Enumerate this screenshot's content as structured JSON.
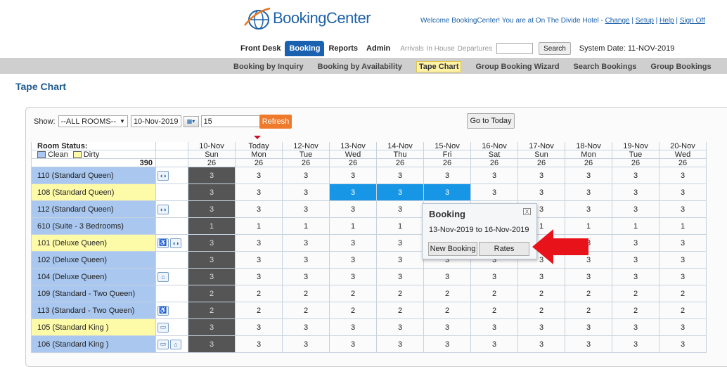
{
  "header": {
    "logo_text": "BookingCenter",
    "welcome_text": "Welcome BookingCenter! You are at On The Divide Hotel - ",
    "links": [
      "Change",
      "Setup",
      "Help",
      "Sign Off"
    ]
  },
  "nav": {
    "tabs": [
      "Front Desk",
      "Booking",
      "Reports",
      "Admin"
    ],
    "active_tab": "Booking",
    "quick_links": [
      "Arrivals",
      "In House",
      "Departures"
    ],
    "search_value": "",
    "search_button": "Search",
    "system_date": "System Date: 11-NOV-2019"
  },
  "subnav": {
    "items": [
      "Booking by Inquiry",
      "Booking by Availability",
      "Tape Chart",
      "Group Booking Wizard",
      "Search Bookings",
      "Group Bookings"
    ],
    "active": "Tape Chart"
  },
  "page_title": "Tape Chart",
  "toolbar": {
    "show_label": "Show:",
    "rooms_select": "--ALL ROOMS--",
    "date_value": "10-Nov-2019",
    "days_value": "15",
    "refresh_label": "Refresh",
    "goto_today_label": "Go to Today"
  },
  "grid": {
    "status_label": "Room Status:",
    "legend_clean": "Clean",
    "legend_dirty": "Dirty",
    "total": "390",
    "dates": [
      "10-Nov",
      "Today",
      "12-Nov",
      "13-Nov",
      "14-Nov",
      "15-Nov",
      "16-Nov",
      "17-Nov",
      "18-Nov",
      "19-Nov",
      "20-Nov"
    ],
    "days": [
      "Sun",
      "Mon",
      "Tue",
      "Wed",
      "Thu",
      "Fri",
      "Sat",
      "Sun",
      "Mon",
      "Tue",
      "Wed"
    ],
    "totals": [
      "26",
      "26",
      "26",
      "26",
      "26",
      "26",
      "26",
      "26",
      "26",
      "26",
      "26"
    ],
    "rooms": [
      {
        "name": "110 (Standard Queen)",
        "status": "clean",
        "icons": [
          "hearing-icon"
        ],
        "values": [
          "3",
          "3",
          "3",
          "3",
          "3",
          "3",
          "3",
          "3",
          "3",
          "3",
          "3"
        ]
      },
      {
        "name": "108 (Standard Queen)",
        "status": "dirty",
        "icons": [],
        "values": [
          "3",
          "3",
          "3",
          "3",
          "3",
          "3",
          "3",
          "3",
          "3",
          "3",
          "3"
        ]
      },
      {
        "name": "112 (Standard Queen)",
        "status": "clean",
        "icons": [
          "hearing-icon"
        ],
        "values": [
          "3",
          "3",
          "3",
          "3",
          "3",
          "3",
          "3",
          "3",
          "3",
          "3",
          "3"
        ]
      },
      {
        "name": "610 (Suite - 3 Bedrooms)",
        "status": "clean",
        "icons": [],
        "values": [
          "1",
          "1",
          "1",
          "1",
          "1",
          "1",
          "1",
          "1",
          "1",
          "1",
          "1"
        ]
      },
      {
        "name": "101 (Deluxe Queen)",
        "status": "dirty",
        "icons": [
          "wheelchair-icon",
          "hearing-icon"
        ],
        "values": [
          "3",
          "3",
          "3",
          "3",
          "3",
          "3",
          "3",
          "3",
          "3",
          "3",
          "3"
        ]
      },
      {
        "name": "102 (Deluxe Queen)",
        "status": "clean",
        "icons": [],
        "values": [
          "3",
          "3",
          "3",
          "3",
          "3",
          "3",
          "3",
          "3",
          "3",
          "3",
          "3"
        ]
      },
      {
        "name": "104 (Deluxe Queen)",
        "status": "clean",
        "icons": [
          "pet-icon"
        ],
        "values": [
          "3",
          "3",
          "3",
          "3",
          "3",
          "3",
          "3",
          "3",
          "3",
          "3",
          "3"
        ]
      },
      {
        "name": "109 (Standard - Two Queen)",
        "status": "clean",
        "icons": [],
        "values": [
          "2",
          "2",
          "2",
          "2",
          "2",
          "2",
          "2",
          "2",
          "2",
          "2",
          "2"
        ]
      },
      {
        "name": "113 (Standard - Two Queen)",
        "status": "clean",
        "icons": [
          "wheelchair-icon"
        ],
        "values": [
          "2",
          "2",
          "2",
          "2",
          "2",
          "2",
          "2",
          "2",
          "2",
          "2",
          "2"
        ]
      },
      {
        "name": "105 (Standard King )",
        "status": "dirty",
        "icons": [
          "no-smoking-icon"
        ],
        "values": [
          "3",
          "3",
          "3",
          "3",
          "3",
          "3",
          "3",
          "3",
          "3",
          "3",
          "3"
        ]
      },
      {
        "name": "106 (Standard King )",
        "status": "clean",
        "icons": [
          "no-smoking-icon",
          "pet-icon"
        ],
        "values": [
          "3",
          "3",
          "3",
          "3",
          "3",
          "3",
          "3",
          "3",
          "3",
          "3",
          "3"
        ]
      }
    ]
  },
  "popup": {
    "title": "Booking",
    "close": "X",
    "range": "13-Nov-2019 to 16-Nov-2019",
    "new_booking": "New Booking",
    "rates": "Rates"
  },
  "colors": {
    "clean": "#a9c7ef",
    "dirty": "#fdfaa8",
    "selected": "#1796e6",
    "arrow": "#e8121b",
    "refresh": "#f07a2b"
  }
}
